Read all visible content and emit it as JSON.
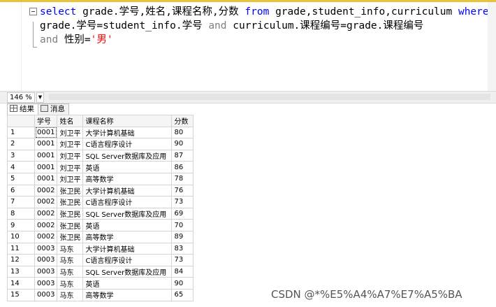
{
  "editor": {
    "lines": [
      [
        {
          "t": "select",
          "c": "kw"
        },
        {
          "t": " grade.学号,姓名,课程名称,分数 ",
          "c": "id"
        },
        {
          "t": "from",
          "c": "kw"
        },
        {
          "t": " grade,student_info,curriculum ",
          "c": "id"
        },
        {
          "t": "where",
          "c": "kw"
        }
      ],
      [
        {
          "t": "grade.学号=student_info.学号 ",
          "c": "id"
        },
        {
          "t": "and",
          "c": "gray"
        },
        {
          "t": " curriculum.课程编号=grade.课程编号",
          "c": "id"
        }
      ],
      [
        {
          "t": "and",
          "c": "gray"
        },
        {
          "t": " 性别=",
          "c": "id"
        },
        {
          "t": "'男'",
          "c": "str"
        }
      ]
    ]
  },
  "zoom": {
    "value": "146 %"
  },
  "tabs": {
    "results": "结果",
    "messages": "消息"
  },
  "grid": {
    "columns": [
      "学号",
      "姓名",
      "课程名称",
      "分数"
    ],
    "rows": [
      [
        "1",
        "0001",
        "刘卫平",
        "大学计算机基础",
        "80"
      ],
      [
        "2",
        "0001",
        "刘卫平",
        "C语言程序设计",
        "90"
      ],
      [
        "3",
        "0001",
        "刘卫平",
        "SQL Server数据库及应用",
        "87"
      ],
      [
        "4",
        "0001",
        "刘卫平",
        "英语",
        "86"
      ],
      [
        "5",
        "0001",
        "刘卫平",
        "高等数学",
        "78"
      ],
      [
        "6",
        "0002",
        "张卫民",
        "大学计算机基础",
        "76"
      ],
      [
        "7",
        "0002",
        "张卫民",
        "C语言程序设计",
        "73"
      ],
      [
        "8",
        "0002",
        "张卫民",
        "SQL Server数据库及应用",
        "69"
      ],
      [
        "9",
        "0002",
        "张卫民",
        "英语",
        "70"
      ],
      [
        "10",
        "0002",
        "张卫民",
        "高等数学",
        "89"
      ],
      [
        "11",
        "0003",
        "马东",
        "大学计算机基础",
        "83"
      ],
      [
        "12",
        "0003",
        "马东",
        "C语言程序设计",
        "73"
      ],
      [
        "13",
        "0003",
        "马东",
        "SQL Server数据库及应用",
        "84"
      ],
      [
        "14",
        "0003",
        "马东",
        "英语",
        "90"
      ],
      [
        "15",
        "0003",
        "马东",
        "高等数学",
        "65"
      ]
    ]
  },
  "watermark": "CSDN @*%E5%A4%A7%E7%A5%BA"
}
